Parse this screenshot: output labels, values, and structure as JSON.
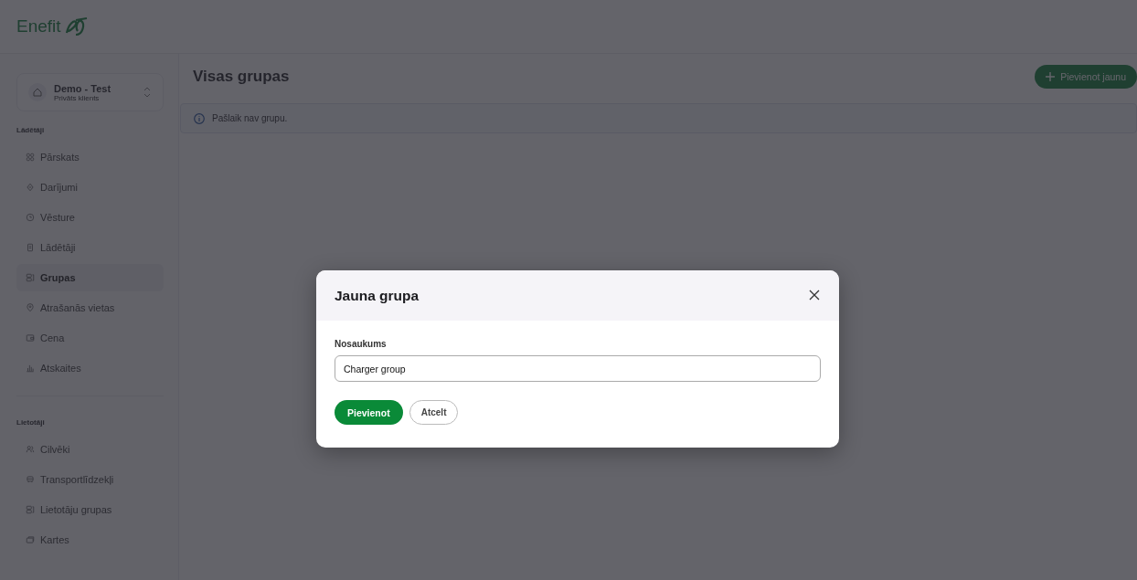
{
  "header": {
    "logo": "Enefit"
  },
  "account": {
    "name": "Demo - Test",
    "type": "Privāts klients"
  },
  "sidebar": {
    "sections": [
      {
        "title": "Lādētāji",
        "items": [
          {
            "label": "Pārskats",
            "selected": false
          },
          {
            "label": "Darījumi",
            "selected": false
          },
          {
            "label": "Vēsture",
            "selected": false
          },
          {
            "label": "Lādētāji",
            "selected": false
          },
          {
            "label": "Grupas",
            "selected": true
          },
          {
            "label": "Atrašanās vietas",
            "selected": false
          },
          {
            "label": "Cena",
            "selected": false
          },
          {
            "label": "Atskaites",
            "selected": false
          }
        ]
      },
      {
        "title": "Lietotāji",
        "items": [
          {
            "label": "Cilvēki",
            "selected": false
          },
          {
            "label": "Transportlīdzekļi",
            "selected": false
          },
          {
            "label": "Lietotāju grupas",
            "selected": false
          },
          {
            "label": "Kartes",
            "selected": false
          }
        ]
      }
    ]
  },
  "page": {
    "title": "Visas grupas",
    "add_button": "Pievienot jaunu",
    "info": "Pašlaik nav grupu."
  },
  "dialog": {
    "title": "Jauna grupa",
    "field_label": "Nosaukums",
    "field_value": "Charger group",
    "submit": "Pievienot",
    "cancel": "Atcelt"
  }
}
